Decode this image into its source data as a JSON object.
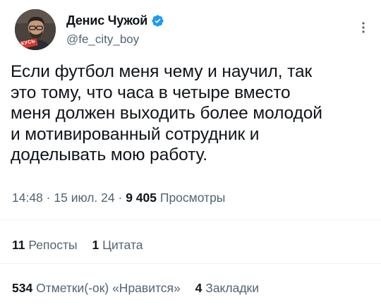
{
  "author": {
    "display_name": "Денис Чужой",
    "handle": "@fe_city_boy",
    "avatar_caption": "КУСЬ",
    "verified_color": "#1d9bf0"
  },
  "tweet": {
    "lines": [
      "Если футбол меня чему и научил, так",
      "это тому, что часа в четыре вместо",
      "меня должен выходить более молодой",
      "и мотивированный сотрудник и",
      "доделывать мою работу."
    ],
    "time": "14:48",
    "date": "15 июл. 24",
    "separator": "·",
    "views_count": "9 405",
    "views_label": "Просмотры"
  },
  "stats": {
    "reposts_count": "11",
    "reposts_label": "Репосты",
    "quotes_count": "1",
    "quotes_label": "Цитата",
    "likes_count": "534",
    "likes_label": "Отметки(-ок) «Нравится»",
    "bookmarks_count": "4",
    "bookmarks_label": "Закладки"
  },
  "colors": {
    "text_primary": "#0f1419",
    "text_secondary": "#536471",
    "divider": "#eff3f4"
  },
  "icons": [
    "verified-badge-icon",
    "more-options-icon"
  ]
}
